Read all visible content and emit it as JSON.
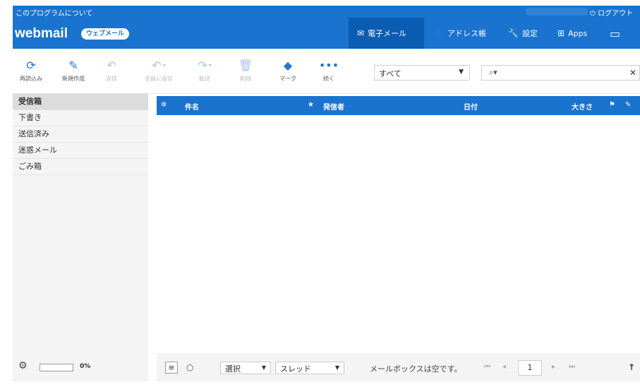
{
  "topbar": {
    "about": "このプログラムについて",
    "logout": "ログアウト",
    "logout_icon": "power-icon"
  },
  "header": {
    "logo": "webmail",
    "badge": "ウェブメール",
    "nav": [
      {
        "label": "電子メール",
        "icon": "envelope-icon",
        "glyph": "✉",
        "active": true
      },
      {
        "label": "アドレス帳",
        "icon": "person-icon",
        "glyph": "👤",
        "active": false
      },
      {
        "label": "設定",
        "icon": "wrench-icon",
        "glyph": "🔧",
        "active": false
      },
      {
        "label": "Apps",
        "icon": "plus-square-icon",
        "glyph": "⊞",
        "active": false
      },
      {
        "label": "",
        "icon": "monitor-icon",
        "glyph": "▭",
        "active": false
      }
    ]
  },
  "toolbar": {
    "refresh": "再読込み",
    "compose": "新規作成",
    "reply": "返信",
    "reply_all": "全員に返信",
    "forward": "転送",
    "delete": "削除",
    "mark": "マーク",
    "more": "続く",
    "filter_value": "すべて",
    "search_placeholder": ""
  },
  "folders": [
    {
      "label": "受信箱",
      "selected": true
    },
    {
      "label": "下書き",
      "selected": false
    },
    {
      "label": "送信済み",
      "selected": false
    },
    {
      "label": "迷惑メール",
      "selected": false
    },
    {
      "label": "ごみ箱",
      "selected": false
    }
  ],
  "quota": {
    "percent": "0%",
    "fraction": 0
  },
  "list": {
    "col_subject": "件名",
    "col_from": "発信者",
    "col_date": "日付",
    "col_size": "大きさ"
  },
  "footer": {
    "select_label": "選択",
    "thread_label": "スレッド",
    "empty_message": "メールボックスは空です。",
    "page": "1"
  },
  "colors": {
    "header_bg": "#1a73cf",
    "nav_active_bg": "#0b5db3",
    "panel_bg": "#f4f4f4"
  }
}
